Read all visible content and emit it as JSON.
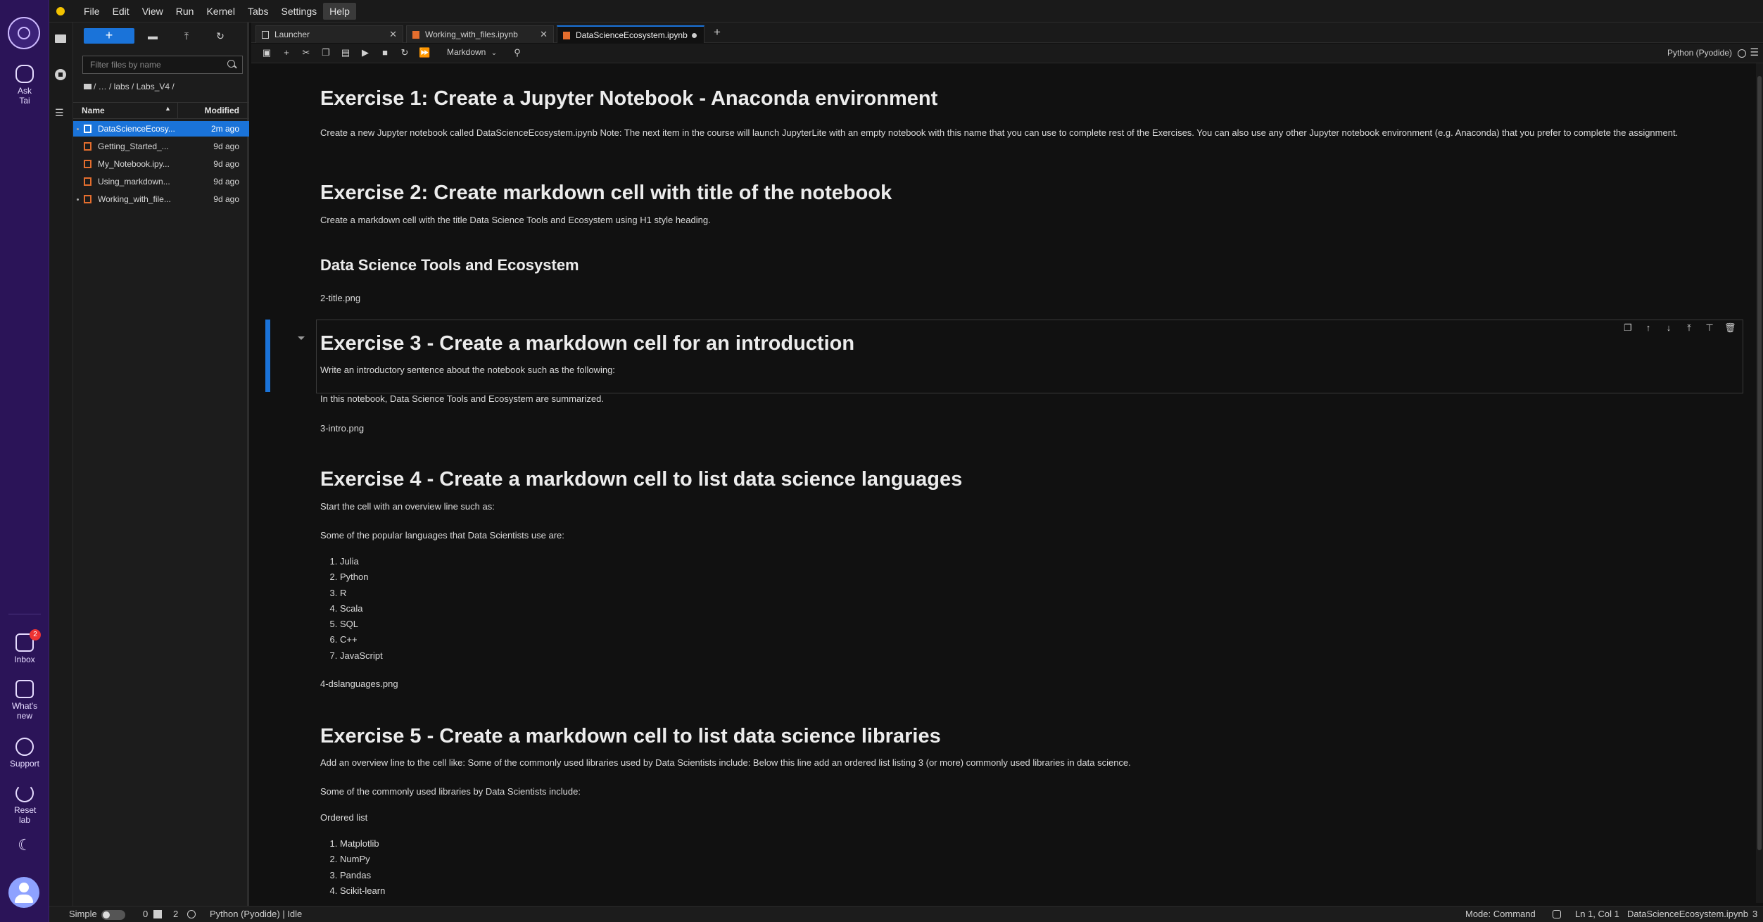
{
  "rail": {
    "ask_label": "Ask Tai",
    "inbox_label": "Inbox",
    "inbox_count": "2",
    "whats_new_label": "What's new",
    "support_label": "Support",
    "reset_label": "Reset lab"
  },
  "menubar": {
    "items": [
      "File",
      "Edit",
      "View",
      "Run",
      "Kernel",
      "Tabs",
      "Settings",
      "Help"
    ]
  },
  "filebrowser": {
    "new_label": "+",
    "filter_placeholder": "Filter files by name",
    "breadcrumb": "/ … / labs / Labs_V4 /",
    "col_name": "Name",
    "col_modified": "Modified",
    "files": [
      {
        "name": "DataScienceEcosy...",
        "modified": "2m ago"
      },
      {
        "name": "Getting_Started_...",
        "modified": "9d ago"
      },
      {
        "name": "My_Notebook.ipy...",
        "modified": "9d ago"
      },
      {
        "name": "Using_markdown...",
        "modified": "9d ago"
      },
      {
        "name": "Working_with_file...",
        "modified": "9d ago"
      }
    ]
  },
  "tabs": [
    {
      "label": "Launcher"
    },
    {
      "label": "Working_with_files.ipynb"
    },
    {
      "label": "DataScienceEcosystem.ipynb"
    }
  ],
  "toolbar": {
    "cell_type": "Markdown",
    "kernel": "Python (Pyodide)"
  },
  "notebook": {
    "ex1_title": "Exercise 1: Create a Jupyter Notebook - Anaconda environment",
    "ex1_text": "Create a new Jupyter notebook called DataScienceEcosystem.ipynb Note: The next item in the course will launch JupyterLite with an empty notebook with this name that you can use to complete rest of the Exercises. You can also use any other Jupyter notebook environment (e.g. Anaconda) that you prefer to complete the assignment.",
    "ex2_title": "Exercise 2: Create markdown cell with title of the notebook",
    "ex2_text": "Create a markdown cell with the title Data Science Tools and Ecosystem using H1 style heading.",
    "ex2_sub": "Data Science Tools and Ecosystem",
    "ex2_img": "2-title.png",
    "ex3_title": "Exercise 3 - Create a markdown cell for an introduction",
    "ex3_text": "Write an introductory sentence about the notebook such as the following:",
    "ex3_quote": "In this notebook, Data Science Tools and Ecosystem are summarized.",
    "ex3_img": "3-intro.png",
    "ex4_title": "Exercise 4 - Create a markdown cell to list data science languages",
    "ex4_text": "Start the cell with an overview line such as:",
    "ex4_line": "Some of the popular languages that Data Scientists use are:",
    "ex4_list": [
      "Julia",
      "Python",
      "R",
      "Scala",
      "SQL",
      "C++",
      "JavaScript"
    ],
    "ex4_img": "4-dslanguages.png",
    "ex5_title": "Exercise 5 - Create a markdown cell to list data science libraries",
    "ex5_text": "Add an overview line to the cell like: Some of the commonly used libraries used by Data Scientists include: Below this line add an ordered list listing 3 (or more) commonly used libraries in data science.",
    "ex5_line": "Some of the commonly used libraries by Data Scientists include:",
    "ex5_ordered": "Ordered list",
    "ex5_list": [
      "Matplotlib",
      "NumPy",
      "Pandas",
      "Scikit-learn"
    ]
  },
  "statusbar": {
    "simple": "Simple",
    "terminals": "0",
    "kernels": "2",
    "kernel_status": "Python (Pyodide) | Idle",
    "mode": "Mode: Command",
    "cursor": "Ln 1, Col 1",
    "file": "DataScienceEcosystem.ipynb",
    "count": "3"
  },
  "colors": {
    "accent": "#1a73d9",
    "rail": "#2b1458",
    "notebook_icon": "#e46e2e"
  }
}
